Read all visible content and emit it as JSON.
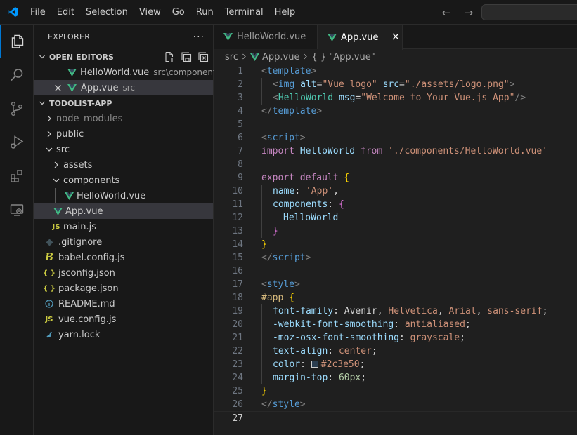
{
  "menu": [
    "File",
    "Edit",
    "Selection",
    "View",
    "Go",
    "Run",
    "Terminal",
    "Help"
  ],
  "explorer": {
    "title": "EXPLORER",
    "more": "···",
    "open_editors": {
      "header": "OPEN EDITORS",
      "items": [
        {
          "name": "HelloWorld.vue",
          "desc": "src\\components"
        },
        {
          "name": "App.vue",
          "desc": "src"
        }
      ]
    },
    "project": {
      "header": "TODOLIST-APP",
      "items": [
        {
          "name": "node_modules"
        },
        {
          "name": "public"
        },
        {
          "name": "src"
        },
        {
          "name": "assets"
        },
        {
          "name": "components"
        },
        {
          "name": "HelloWorld.vue"
        },
        {
          "name": "App.vue"
        },
        {
          "name": "main.js"
        },
        {
          "name": ".gitignore"
        },
        {
          "name": "babel.config.js"
        },
        {
          "name": "jsconfig.json"
        },
        {
          "name": "package.json"
        },
        {
          "name": "README.md"
        },
        {
          "name": "vue.config.js"
        },
        {
          "name": "yarn.lock"
        }
      ]
    }
  },
  "tabs": [
    {
      "label": "HelloWorld.vue",
      "active": false
    },
    {
      "label": "App.vue",
      "active": true
    }
  ],
  "breadcrumb": {
    "folder": "src",
    "file": "App.vue",
    "symbol": "{ } \"App.vue\""
  },
  "code": {
    "line_numbers": [
      "1",
      "2",
      "3",
      "4",
      "5",
      "6",
      "7",
      "8",
      "9",
      "10",
      "11",
      "12",
      "13",
      "14",
      "15",
      "16",
      "17",
      "18",
      "19",
      "20",
      "21",
      "22",
      "23",
      "24",
      "25",
      "26",
      "27"
    ],
    "current_line": 27,
    "l1": [
      "<",
      "template",
      ">"
    ],
    "l2": [
      "<",
      "img",
      "alt",
      "=",
      "\"Vue logo\"",
      "src",
      "=",
      "\"",
      "./assets/logo.png",
      "\"",
      ">"
    ],
    "l3": [
      "<",
      "HelloWorld",
      "msg",
      "=",
      "\"Welcome to Your Vue.js App\"",
      "/>"
    ],
    "l4": [
      "</",
      "template",
      ">"
    ],
    "l6": [
      "<",
      "script",
      ">"
    ],
    "l7": [
      "import",
      "HelloWorld",
      "from",
      "'./components/HelloWorld.vue'"
    ],
    "l9": [
      "export",
      "default",
      "{"
    ],
    "l10": [
      "name",
      ":",
      "'App'",
      ","
    ],
    "l11": [
      "components",
      ":",
      "{"
    ],
    "l12": [
      "HelloWorld"
    ],
    "l13": [
      "}"
    ],
    "l14": [
      "}"
    ],
    "l15": [
      "</",
      "script",
      ">"
    ],
    "l17": [
      "<",
      "style",
      ">"
    ],
    "l18": [
      "#app",
      "{"
    ],
    "l19": [
      "font-family",
      ":",
      "Avenir",
      ",",
      "Helvetica",
      ",",
      "Arial",
      ",",
      "sans-serif",
      ";"
    ],
    "l20": [
      "-webkit-font-smoothing",
      ":",
      "antialiased",
      ";"
    ],
    "l21": [
      "-moz-osx-font-smoothing",
      ":",
      "grayscale",
      ";"
    ],
    "l22": [
      "text-align",
      ":",
      "center",
      ";"
    ],
    "l23": [
      "color",
      ":",
      "#2c3e50",
      ";"
    ],
    "l24": [
      "margin-top",
      ":",
      "60px",
      ";"
    ],
    "l25": [
      "}"
    ],
    "l26": [
      "</",
      "style",
      ">"
    ]
  },
  "colors": {
    "accent": "#0078d4",
    "vue_green": "#41b883",
    "swatch": "#2c3e50",
    "js_yellow": "#cbcb41",
    "json_yellow": "#cbcb41",
    "info_blue": "#519aba"
  },
  "icons": {
    "activity": [
      "explorer-icon",
      "search-icon",
      "source-control-icon",
      "run-debug-icon",
      "extensions-icon",
      "remote-explorer-icon"
    ],
    "js_label": "JS",
    "json_label": "{ }",
    "babel_label": "B"
  }
}
